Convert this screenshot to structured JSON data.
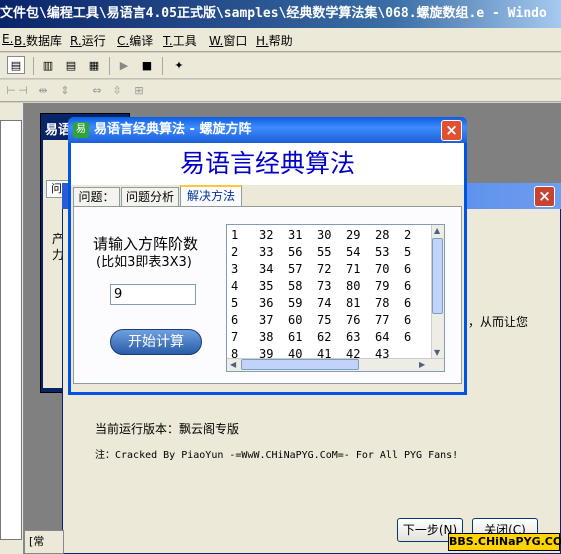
{
  "window": {
    "title": "文件包\\编程工具\\易语言4.05正式版\\samples\\经典数学算法集\\068.螺旋数组.e - Windo"
  },
  "menu": [
    {
      "key": "B.",
      "label": "数据库"
    },
    {
      "key": "R.",
      "label": "运行"
    },
    {
      "key": "C.",
      "label": "编译"
    },
    {
      "key": "T.",
      "label": "工具"
    },
    {
      "key": "W.",
      "label": "窗口"
    },
    {
      "key": "H.",
      "label": "帮助"
    }
  ],
  "menu_first_key": "E.",
  "behind": {
    "editor_title_partial": "易语",
    "editor_tab": "问",
    "editor_text1": "产",
    "editor_text2": "力",
    "big_text": "，从而让您",
    "version_text": "当前运行版本：飘云阁专版",
    "cracked_text": "注：Cracked By PiaoYun -=WwW.CHiNaPYG.CoM=- For All PYG Fans!",
    "next_button": "下一步(N)",
    "close_button": "关闭(C)",
    "bottom_tab": "[常"
  },
  "dialog": {
    "title": "易语言经典算法 - 螺旋方阵",
    "headline": "易语言经典算法",
    "tabs": [
      {
        "label": "问题："
      },
      {
        "label": "问题分析"
      },
      {
        "label": "解决方法"
      }
    ],
    "prompt_line1": "请输入方阵阶数",
    "prompt_line2": "(比如3即表3X3)",
    "input_value": "9",
    "start_button": "开始计算"
  },
  "matrix": [
    [
      "1",
      "32",
      "31",
      "30",
      "29",
      "28",
      "2"
    ],
    [
      "2",
      "33",
      "56",
      "55",
      "54",
      "53",
      "5"
    ],
    [
      "3",
      "34",
      "57",
      "72",
      "71",
      "70",
      "6"
    ],
    [
      "4",
      "35",
      "58",
      "73",
      "80",
      "79",
      "6"
    ],
    [
      "5",
      "36",
      "59",
      "74",
      "81",
      "78",
      "6"
    ],
    [
      "6",
      "37",
      "60",
      "75",
      "76",
      "77",
      "6"
    ],
    [
      "7",
      "38",
      "61",
      "62",
      "63",
      "64",
      "6"
    ],
    [
      "8",
      "39",
      "40",
      "41",
      "42",
      "43",
      ""
    ]
  ],
  "watermark": "BBS.CHiNaPYG.COM",
  "colors": {
    "title_blue": "#0054e3",
    "headline_text": "#0000c8",
    "xp_beige": "#ece9d8"
  }
}
